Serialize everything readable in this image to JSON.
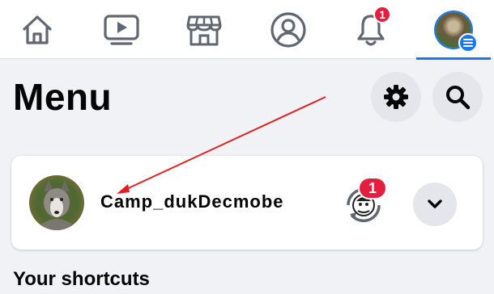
{
  "nav": {
    "notifications_count": "1",
    "tabs": [
      "home",
      "watch",
      "marketplace",
      "profile",
      "notifications",
      "menu"
    ]
  },
  "header": {
    "title": "Menu"
  },
  "profile": {
    "name": "Camp_dukDecmobe",
    "switcher_badge": "1"
  },
  "sections": {
    "shortcuts_title": "Your shortcuts"
  },
  "colors": {
    "accent": "#1877f2",
    "badge": "#e41e3f",
    "annotation": "#e0201e"
  }
}
